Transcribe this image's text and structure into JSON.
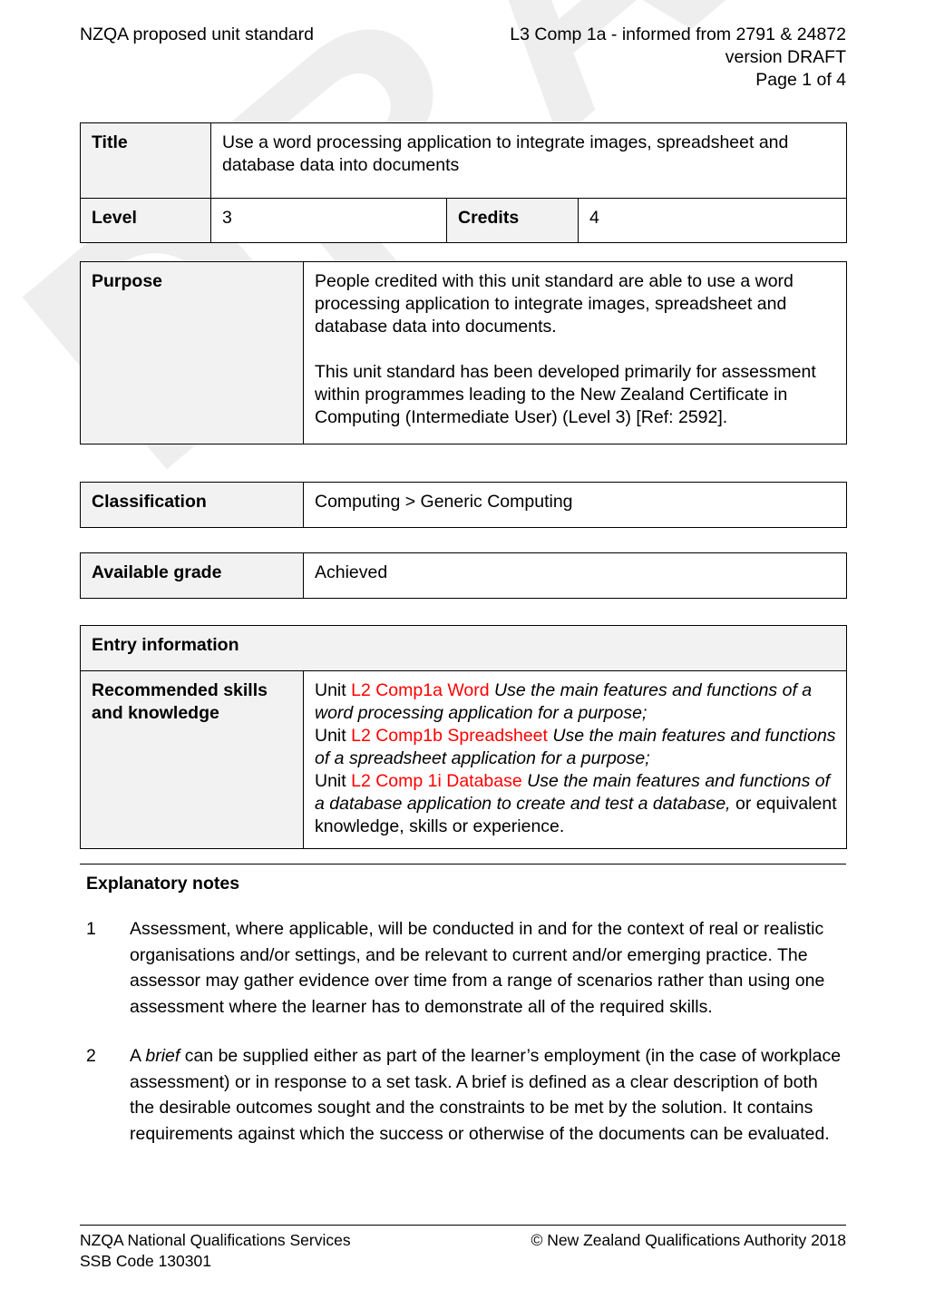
{
  "header": {
    "left": "NZQA proposed unit standard",
    "right_line1": "L3 Comp 1a  - informed from 2791 & 24872",
    "right_line2": "version DRAFT",
    "right_line3": "Page 1 of 4"
  },
  "watermark": {
    "text": "DRAFT",
    "color": "#eeeeee"
  },
  "title_table": {
    "title_label": "Title",
    "title_value": "Use a word processing application to integrate images, spreadsheet and database data into documents",
    "level_label": "Level",
    "level_value": "3",
    "credits_label": "Credits",
    "credits_value": "4"
  },
  "purpose": {
    "label": "Purpose",
    "paragraph1": "People credited with this unit standard are able to use a word processing application to integrate images, spreadsheet and database data into documents.",
    "paragraph2": "This unit standard has been developed primarily for assessment within programmes leading to the New Zealand Certificate in Computing (Intermediate User) (Level 3) [Ref: 2592]."
  },
  "classification": {
    "label": "Classification",
    "value": "Computing > Generic Computing"
  },
  "available_grade": {
    "label": "Available grade",
    "value": "Achieved"
  },
  "entry_information": {
    "header": "Entry information",
    "label": "Recommended skills and knowledge",
    "items": [
      {
        "prefix": "Unit ",
        "code": "L2 Comp1a Word",
        "description": " Use the main features and functions of a word processing application for a purpose;"
      },
      {
        "prefix": "Unit ",
        "code": "L2 Comp1b Spreadsheet",
        "description": " Use the main features and functions of a spreadsheet application for a purpose;"
      },
      {
        "prefix": "Unit ",
        "code": "L2 Comp 1i Database",
        "description": " Use the main features and functions of a database application to create and test a database,"
      }
    ],
    "tail": " or equivalent knowledge, skills or experience.",
    "code_color": "#ff0000"
  },
  "explanatory_notes": {
    "heading": "Explanatory notes",
    "notes": [
      {
        "number": "1",
        "text": "Assessment, where applicable, will be conducted in and for the context of real or realistic organisations and/or settings, and be relevant to current and/or emerging practice.  The assessor may gather evidence over time from a range of scenarios rather than using one assessment where the learner has to demonstrate all of the required skills."
      },
      {
        "number": "2",
        "text_pre": "A ",
        "emphasis": "brief",
        "text_post": " can be supplied either as part of the learner’s employment (in the case of workplace assessment) or in response to a set task.  A brief is defined as a clear description of both the desirable outcomes sought and the constraints to be met by the solution.  It contains requirements against which the success or otherwise of the documents can be evaluated."
      }
    ]
  },
  "footer": {
    "left": "NZQA National Qualifications Services\nSSB Code 130301",
    "right": "© New Zealand Qualifications Authority 2018"
  }
}
